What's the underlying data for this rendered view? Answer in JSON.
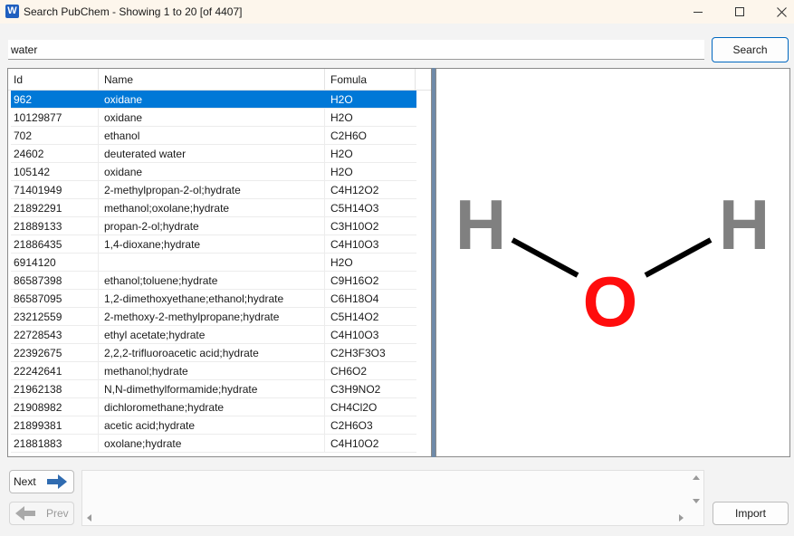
{
  "window": {
    "title": "Search PubChem - Showing 1 to 20 [of 4407]",
    "app_icon_letter": "W"
  },
  "search": {
    "query": "water",
    "button_label": "Search"
  },
  "table": {
    "columns": [
      "Id",
      "Name",
      "Fomula"
    ],
    "selected_index": 0,
    "rows": [
      {
        "id": "962",
        "name": "oxidane",
        "formula": "H2O"
      },
      {
        "id": "10129877",
        "name": "oxidane",
        "formula": "H2O"
      },
      {
        "id": "702",
        "name": "ethanol",
        "formula": "C2H6O"
      },
      {
        "id": "24602",
        "name": "deuterated water",
        "formula": "H2O"
      },
      {
        "id": "105142",
        "name": "oxidane",
        "formula": "H2O"
      },
      {
        "id": "71401949",
        "name": "2-methylpropan-2-ol;hydrate",
        "formula": "C4H12O2"
      },
      {
        "id": "21892291",
        "name": "methanol;oxolane;hydrate",
        "formula": "C5H14O3"
      },
      {
        "id": "21889133",
        "name": "propan-2-ol;hydrate",
        "formula": "C3H10O2"
      },
      {
        "id": "21886435",
        "name": "1,4-dioxane;hydrate",
        "formula": "C4H10O3"
      },
      {
        "id": "6914120",
        "name": "",
        "formula": "H2O"
      },
      {
        "id": "86587398",
        "name": "ethanol;toluene;hydrate",
        "formula": "C9H16O2"
      },
      {
        "id": "86587095",
        "name": "1,2-dimethoxyethane;ethanol;hydrate",
        "formula": "C6H18O4"
      },
      {
        "id": "23212559",
        "name": "2-methoxy-2-methylpropane;hydrate",
        "formula": "C5H14O2"
      },
      {
        "id": "22728543",
        "name": "ethyl acetate;hydrate",
        "formula": "C4H10O3"
      },
      {
        "id": "22392675",
        "name": "2,2,2-trifluoroacetic acid;hydrate",
        "formula": "C2H3F3O3"
      },
      {
        "id": "22242641",
        "name": "methanol;hydrate",
        "formula": "CH6O2"
      },
      {
        "id": "21962138",
        "name": "N,N-dimethylformamide;hydrate",
        "formula": "C3H9NO2"
      },
      {
        "id": "21908982",
        "name": "dichloromethane;hydrate",
        "formula": "CH4Cl2O"
      },
      {
        "id": "21899381",
        "name": "acetic acid;hydrate",
        "formula": "C2H6O3"
      },
      {
        "id": "21881883",
        "name": "oxolane;hydrate",
        "formula": "C4H10O2"
      }
    ]
  },
  "structure": {
    "atoms": {
      "left": "H",
      "center": "O",
      "right": "H"
    },
    "colors": {
      "hydrogen": "#808080",
      "oxygen": "#ff0d0d",
      "bond": "#000000"
    }
  },
  "pagination": {
    "next_label": "Next",
    "prev_label": "Prev"
  },
  "actions": {
    "import_label": "Import"
  },
  "colors": {
    "selection": "#0078d7",
    "accent_border": "#0067c0"
  }
}
